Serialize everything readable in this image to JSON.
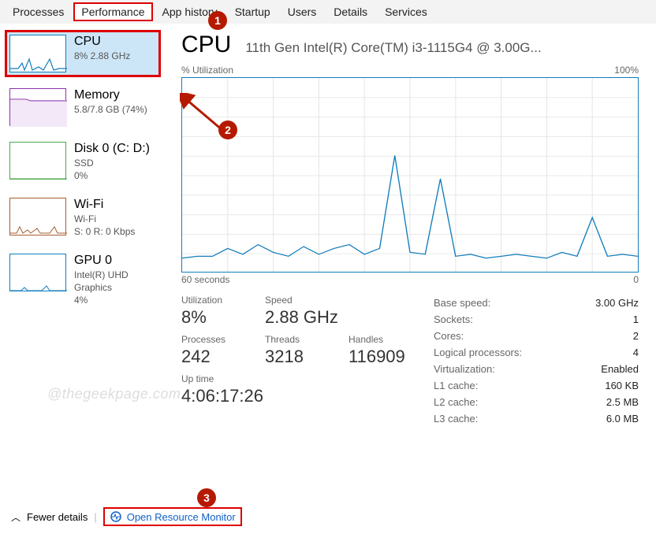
{
  "tabs": {
    "processes": "Processes",
    "performance": "Performance",
    "app_history": "App history",
    "startup": "Startup",
    "users": "Users",
    "details": "Details",
    "services": "Services"
  },
  "sidebar": {
    "cpu": {
      "title": "CPU",
      "sub": "8%  2.88 GHz"
    },
    "memory": {
      "title": "Memory",
      "sub": "5.8/7.8 GB (74%)"
    },
    "disk": {
      "title": "Disk 0 (C: D:)",
      "sub1": "SSD",
      "sub2": "0%"
    },
    "wifi": {
      "title": "Wi-Fi",
      "sub1": "Wi-Fi",
      "sub2": "S: 0 R: 0 Kbps"
    },
    "gpu": {
      "title": "GPU 0",
      "sub1": "Intel(R) UHD Graphics",
      "sub2": "4%"
    }
  },
  "detail": {
    "title": "CPU",
    "processor": "11th Gen Intel(R) Core(TM) i3-1115G4 @ 3.00G...",
    "chart_top_left": "% Utilization",
    "chart_top_right": "100%",
    "chart_bottom_left": "60 seconds",
    "chart_bottom_right": "0",
    "stats": {
      "utilization": {
        "label": "Utilization",
        "value": "8%"
      },
      "speed": {
        "label": "Speed",
        "value": "2.88 GHz"
      },
      "processes": {
        "label": "Processes",
        "value": "242"
      },
      "threads": {
        "label": "Threads",
        "value": "3218"
      },
      "handles": {
        "label": "Handles",
        "value": "116909"
      },
      "uptime": {
        "label": "Up time",
        "value": "4:06:17:26"
      }
    },
    "info": {
      "base_speed": {
        "label": "Base speed:",
        "value": "3.00 GHz"
      },
      "sockets": {
        "label": "Sockets:",
        "value": "1"
      },
      "cores": {
        "label": "Cores:",
        "value": "2"
      },
      "logical": {
        "label": "Logical processors:",
        "value": "4"
      },
      "virtualization": {
        "label": "Virtualization:",
        "value": "Enabled"
      },
      "l1": {
        "label": "L1 cache:",
        "value": "160 KB"
      },
      "l2": {
        "label": "L2 cache:",
        "value": "2.5 MB"
      },
      "l3": {
        "label": "L3 cache:",
        "value": "6.0 MB"
      }
    }
  },
  "footer": {
    "fewer": "Fewer details",
    "resmon": "Open Resource Monitor"
  },
  "watermark": "@thegeekpage.com",
  "annotations": {
    "badge1": "1",
    "badge2": "2",
    "badge3": "3"
  },
  "chart_data": {
    "type": "line",
    "title": "CPU % Utilization",
    "xlabel": "seconds",
    "ylabel": "% Utilization",
    "ylim": [
      0,
      100
    ],
    "xlim": [
      60,
      0
    ],
    "x": [
      60,
      58,
      56,
      54,
      52,
      50,
      48,
      46,
      44,
      42,
      40,
      38,
      36,
      34,
      32,
      30,
      28,
      26,
      24,
      22,
      20,
      18,
      16,
      14,
      12,
      10,
      8,
      6,
      4,
      2,
      0
    ],
    "values": [
      7,
      8,
      8,
      12,
      9,
      14,
      10,
      8,
      13,
      9,
      12,
      14,
      9,
      12,
      60,
      10,
      9,
      48,
      8,
      9,
      7,
      8,
      9,
      8,
      7,
      10,
      8,
      28,
      8,
      9,
      8
    ]
  }
}
